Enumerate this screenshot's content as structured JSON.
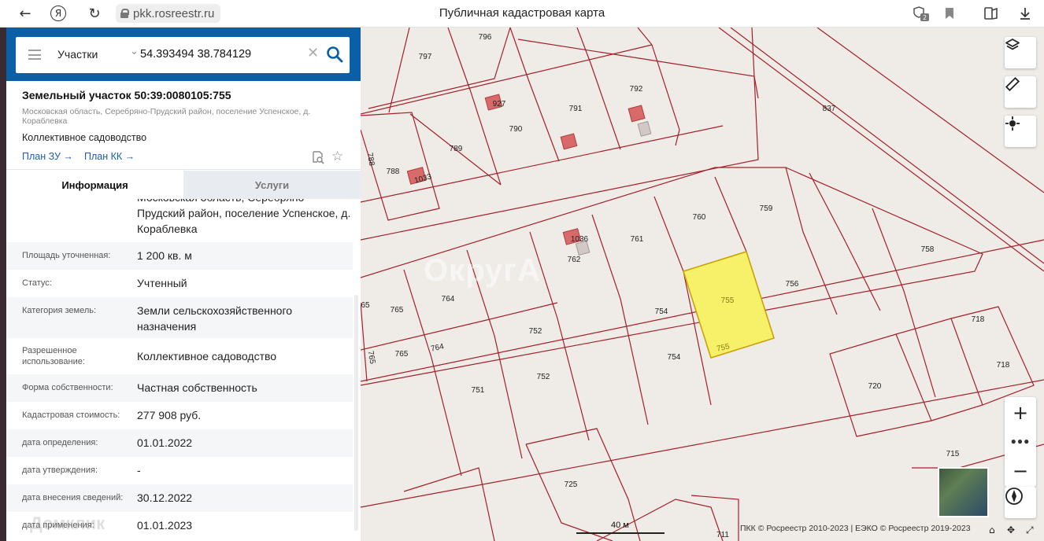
{
  "browser": {
    "url": "pkk.rosreestr.ru",
    "title": "Публичная кадастровая карта",
    "yandex_label": "Я",
    "notif_count": "2"
  },
  "search": {
    "type_label": "Участки",
    "query": "54.393494 38.784129"
  },
  "parcel": {
    "title": "Земельный участок 50:39:0080105:755",
    "address": "Московская область, Серебряно-Прудский район, поселение Успенское, д. Кораблевка",
    "type": "Коллективное садоводство",
    "plan_zu": "План ЗУ →",
    "plan_kk": "План КК →"
  },
  "tabs": {
    "info": "Информация",
    "services": "Услуги"
  },
  "rows": {
    "address_cont": "Московская область, Серебряно-Прудский район, поселение Успенское, д. Кораблевка",
    "area_label": "Площадь уточненная:",
    "area_value": "1 200 кв. м",
    "status_label": "Статус:",
    "status_value": "Учтенный",
    "category_label": "Категория земель:",
    "category_value": "Земли сельскохозяйственного назначения",
    "use_label": "Разрешенное использование:",
    "use_value": "Коллективное садоводство",
    "ownership_label": "Форма собственности:",
    "ownership_value": "Частная собственность",
    "cost_label": "Кадастровая стоимость:",
    "cost_value": "277 908 руб.",
    "def_date_label": "дата определения:",
    "def_date_value": "01.01.2022",
    "approve_date_label": "дата утверждения:",
    "approve_date_value": "-",
    "entry_date_label": "дата внесения сведений:",
    "entry_date_value": "30.12.2022",
    "apply_date_label": "дата применения:",
    "apply_date_value": "01.01.2023"
  },
  "watermark_left": "Домклик",
  "map": {
    "watermark": "ОкругА",
    "scale_label": "40 м",
    "attribution": "ПКК © Росреестр 2010-2023 | ЕЭКО © Росреестр 2019-2023",
    "highlight_color": "#f7f16a",
    "boundary_color": "#a3202a",
    "labels": {
      "l796": "796",
      "l797": "797",
      "l792": "792",
      "l791": "791",
      "l790": "790",
      "l927": "927",
      "l789": "789",
      "l788": "788",
      "l788b": "788",
      "l1033": "1033",
      "l837": "837",
      "l760": "760",
      "l759": "759",
      "l761": "761",
      "l1036": "1036",
      "l762": "762",
      "l758": "758",
      "l756": "756",
      "l755a": "755",
      "l755b": "755",
      "l754a": "754",
      "l754b": "754",
      "l764a": "764",
      "l764b": "764",
      "l765a": "765",
      "l765b": "765",
      "l765c": "765",
      "l65": "65",
      "l752a": "752",
      "l752b": "752",
      "l751": "751",
      "l718a": "718",
      "l718b": "718",
      "l720": "720",
      "l715": "715",
      "l725": "725",
      "l711": "711"
    }
  }
}
